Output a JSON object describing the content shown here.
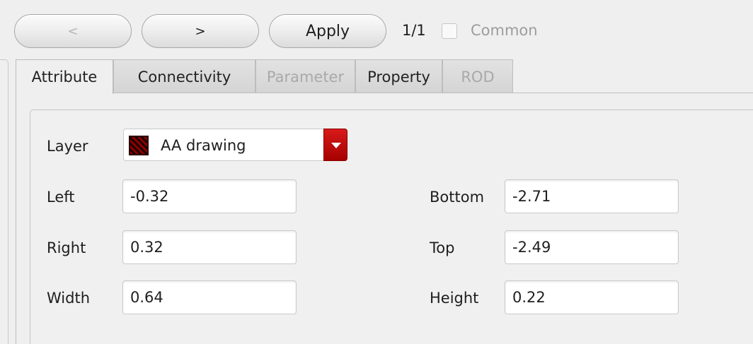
{
  "toolbar": {
    "prev_label": "<",
    "next_label": ">",
    "apply_label": "Apply",
    "counter": "1/1",
    "common_label": "Common",
    "common_checked": false
  },
  "tabs": [
    {
      "label": "Attribute",
      "active": true,
      "enabled": true
    },
    {
      "label": "Connectivity",
      "active": false,
      "enabled": true
    },
    {
      "label": "Parameter",
      "active": false,
      "enabled": false
    },
    {
      "label": "Property",
      "active": false,
      "enabled": true
    },
    {
      "label": "ROD",
      "active": false,
      "enabled": false
    }
  ],
  "attribute": {
    "layer_label": "Layer",
    "layer_value": "AA drawing",
    "layer_swatch_color": "#8a0000",
    "dropdown_accent": "#c00000",
    "left_label": "Left",
    "left_value": "-0.32",
    "right_label": "Right",
    "right_value": "0.32",
    "width_label": "Width",
    "width_value": "0.64",
    "bottom_label": "Bottom",
    "bottom_value": "-2.71",
    "top_label": "Top",
    "top_value": "-2.49",
    "height_label": "Height",
    "height_value": "0.22"
  }
}
